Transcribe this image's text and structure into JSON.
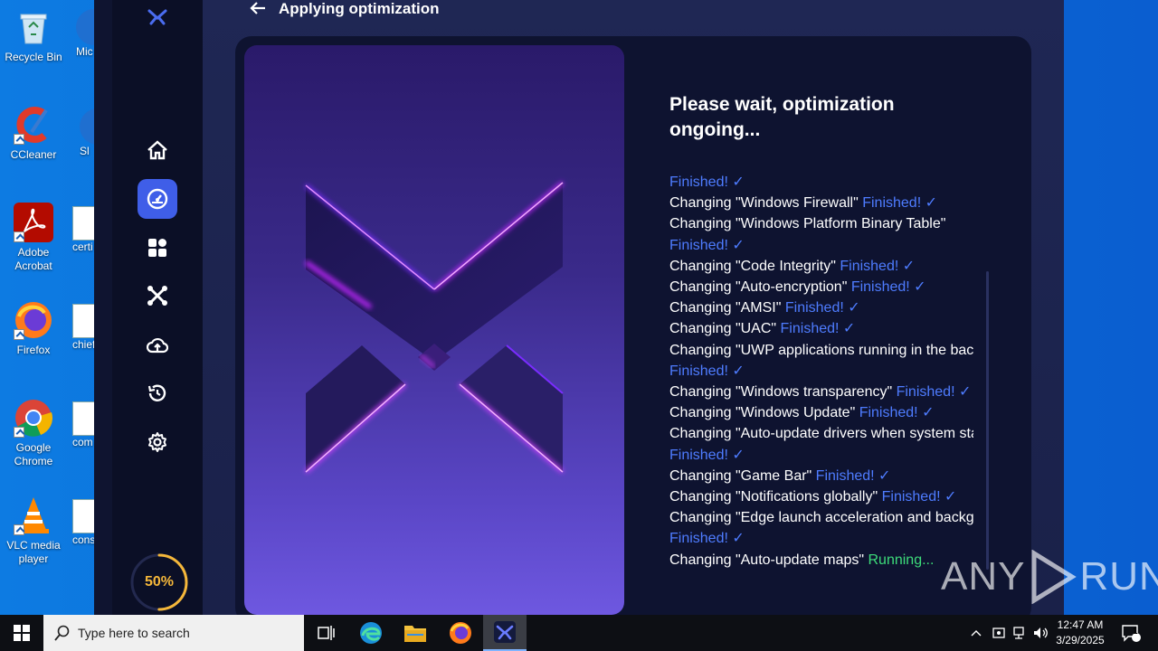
{
  "desktop": {
    "icons": [
      {
        "label": "Recycle Bin"
      },
      {
        "label": "CCleaner"
      },
      {
        "label": "Adobe Acrobat"
      },
      {
        "label": "Firefox"
      },
      {
        "label": "Google Chrome"
      },
      {
        "label": "VLC media player"
      }
    ],
    "partial_icons": [
      "Mic E",
      "Sl",
      "certi",
      "chief",
      "com",
      "cons"
    ]
  },
  "app": {
    "header": {
      "back_icon": "arrow-left-icon",
      "title": "Applying optimization"
    },
    "sidebar": {
      "logo_icon": "x-logo-icon",
      "nav": [
        {
          "name": "home",
          "icon": "home-icon"
        },
        {
          "name": "optimize",
          "icon": "speedometer-icon",
          "active": true
        },
        {
          "name": "apps",
          "icon": "grid-icon"
        },
        {
          "name": "tweaks",
          "icon": "x-tool-icon"
        },
        {
          "name": "cloud",
          "icon": "cloud-upload-icon"
        },
        {
          "name": "history",
          "icon": "history-icon"
        },
        {
          "name": "settings",
          "icon": "gear-icon"
        }
      ],
      "progress": {
        "value": 0.5,
        "label": "50%"
      }
    },
    "content": {
      "title": "Please wait, optimization ongoing...",
      "log": [
        {
          "text": "",
          "status": "Finished! ✓",
          "state": "ok"
        },
        {
          "text": "Changing \"Windows Firewall\" ",
          "status": "Finished! ✓",
          "state": "ok"
        },
        {
          "text": "Changing \"Windows Platform Binary Table\"",
          "status": "",
          "state": "none"
        },
        {
          "text": "",
          "status": "Finished! ✓",
          "state": "ok"
        },
        {
          "text": "Changing \"Code Integrity\" ",
          "status": "Finished! ✓",
          "state": "ok"
        },
        {
          "text": "Changing \"Auto-encryption\" ",
          "status": "Finished! ✓",
          "state": "ok"
        },
        {
          "text": "Changing \"AMSI\" ",
          "status": "Finished! ✓",
          "state": "ok"
        },
        {
          "text": "Changing \"UAC\" ",
          "status": "Finished! ✓",
          "state": "ok"
        },
        {
          "text": "Changing \"UWP applications running in the backg",
          "status": "",
          "state": "none"
        },
        {
          "text": "",
          "status": "Finished! ✓",
          "state": "ok"
        },
        {
          "text": "Changing \"Windows transparency\" ",
          "status": "Finished! ✓",
          "state": "ok"
        },
        {
          "text": "Changing \"Windows Update\" ",
          "status": "Finished! ✓",
          "state": "ok"
        },
        {
          "text": "Changing \"Auto-update drivers when system starts",
          "status": "",
          "state": "none"
        },
        {
          "text": "",
          "status": "Finished! ✓",
          "state": "ok"
        },
        {
          "text": "Changing \"Game Bar\" ",
          "status": "Finished! ✓",
          "state": "ok"
        },
        {
          "text": "Changing \"Notifications globally\" ",
          "status": "Finished! ✓",
          "state": "ok"
        },
        {
          "text": "Changing \"Edge launch acceleration and backgro",
          "status": "",
          "state": "none"
        },
        {
          "text": "",
          "status": "Finished! ✓",
          "state": "ok"
        },
        {
          "text": "Changing \"Auto-update maps\" ",
          "status": "Running...",
          "state": "run"
        }
      ]
    }
  },
  "watermark": {
    "left": "ANY",
    "right": "RUN"
  },
  "taskbar": {
    "search_placeholder": "Type here to search",
    "time": "12:47 AM",
    "date": "3/29/2025",
    "notification_count": "1"
  },
  "colors": {
    "accent": "#3f5ee8",
    "finished": "#4e7cff",
    "running": "#3ddc7a",
    "progress": "#f5b73a"
  }
}
